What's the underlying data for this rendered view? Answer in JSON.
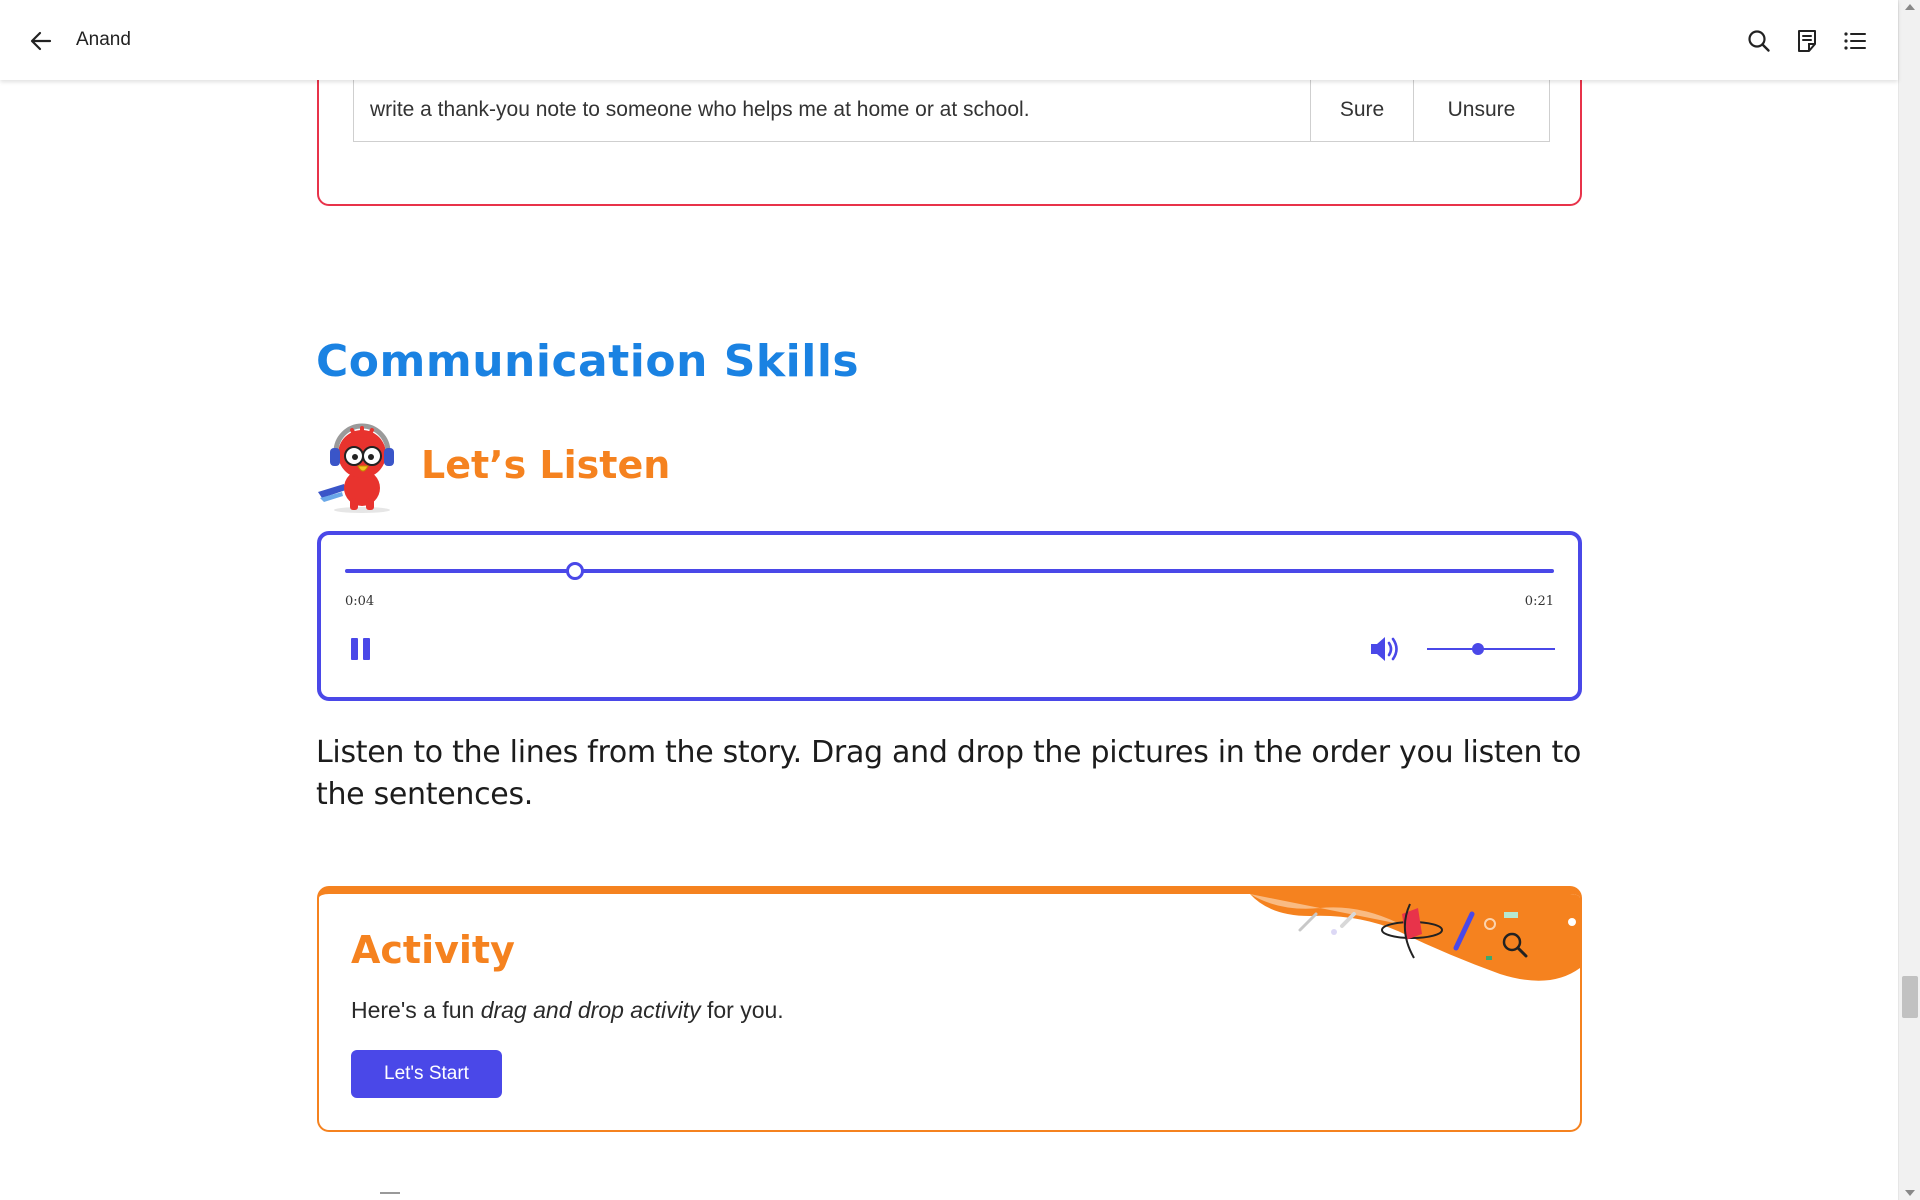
{
  "header": {
    "title": "Anand",
    "icons": [
      "back-arrow-icon",
      "search-icon",
      "notes-icon",
      "table-of-contents-icon"
    ]
  },
  "previous_section": {
    "row_text": "write a thank-you note to someone who helps me at home or at school.",
    "option_sure": "Sure",
    "option_unsure": "Unsure",
    "border_color": "#e8334a"
  },
  "section": {
    "heading": "Communication Skills",
    "heading_color": "#1a82e2"
  },
  "listen": {
    "title": "Let’s Listen",
    "mascot": "parrot-with-headphones",
    "title_color": "#f5821f"
  },
  "audio_player": {
    "current_time": "0:04",
    "total_time": "0:21",
    "progress": 0.19,
    "volume": 0.4,
    "state": "playing",
    "accent_color": "#4a48e8"
  },
  "instruction": "Listen to the lines from the story. Drag and drop the pictures in the order you listen to the sentences.",
  "activity": {
    "title": "Activity",
    "desc_before": "Here's a fun ",
    "desc_emphasis": "drag and drop activity",
    "desc_after": " for you.",
    "button_label": "Let's Start",
    "border_color": "#f5821f"
  }
}
